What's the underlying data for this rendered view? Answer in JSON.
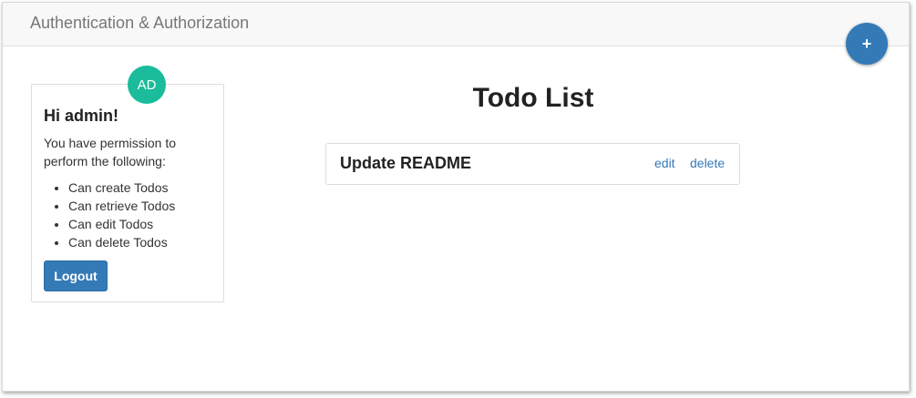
{
  "navbar": {
    "brand": "Authentication & Authorization",
    "add_button_label": "+"
  },
  "user_card": {
    "avatar_initials": "AD",
    "greeting": "Hi admin!",
    "permission_text": "You have permission to perform the following:",
    "permissions": [
      "Can create Todos",
      "Can retrieve Todos",
      "Can edit Todos",
      "Can delete Todos"
    ],
    "logout_label": "Logout"
  },
  "main": {
    "title": "Todo List",
    "todos": [
      {
        "title": "Update README",
        "edit_label": "edit",
        "delete_label": "delete"
      }
    ]
  },
  "colors": {
    "primary": "#337ab7",
    "avatar": "#1abc9c",
    "navbar_bg": "#f8f8f8"
  }
}
